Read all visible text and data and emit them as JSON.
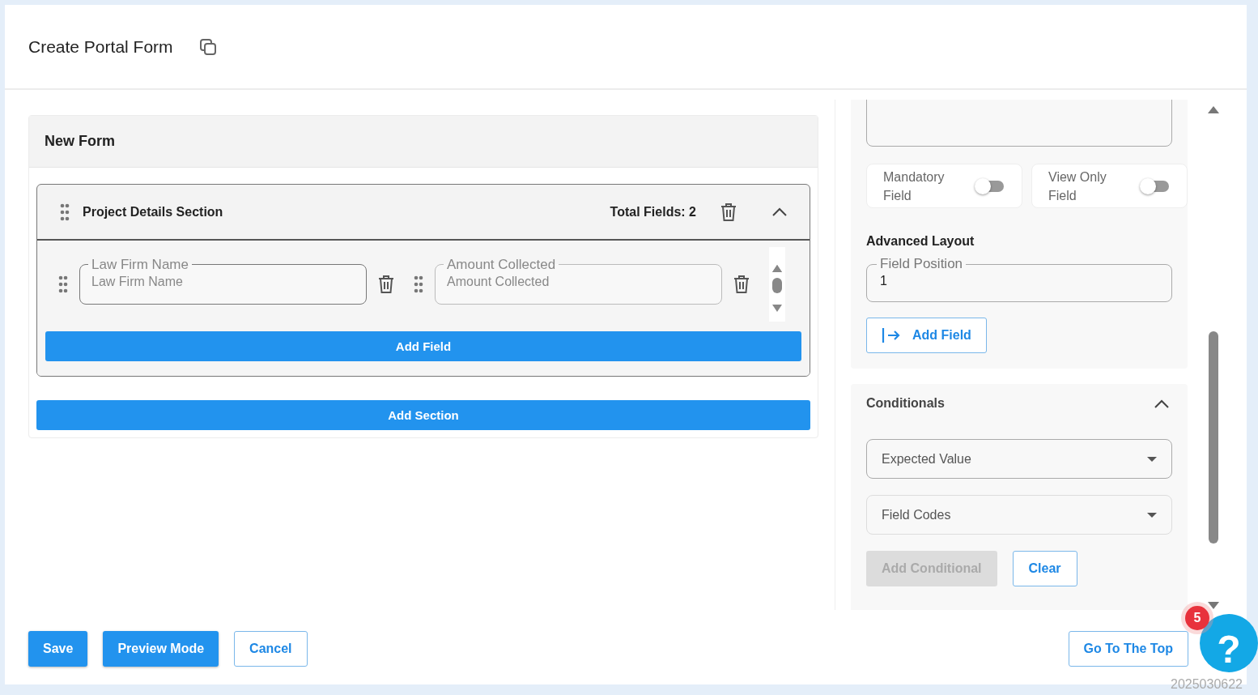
{
  "header": {
    "title": "Create Portal Form"
  },
  "form": {
    "title": "New Form",
    "sections": [
      {
        "title": "Project Details Section",
        "total": "Total Fields: 2",
        "expanded": true,
        "fields": [
          {
            "label": "Law Firm Name",
            "placeholder": "Law Firm Name"
          },
          {
            "label": "Amount Collected",
            "placeholder": "Amount Collected"
          }
        ],
        "add_field": "Add Field"
      }
    ],
    "add_section": "Add Section"
  },
  "properties": {
    "toggles": [
      {
        "label": "Mandatory Field",
        "on": false
      },
      {
        "label": "View Only Field",
        "on": false
      }
    ],
    "advanced_layout": {
      "title": "Advanced Layout",
      "field_position": {
        "label": "Field Position",
        "value": "1"
      },
      "add_field": "Add Field"
    },
    "conditionals": {
      "title": "Conditionals",
      "expanded": true,
      "selects": [
        {
          "placeholder": "Expected Value"
        },
        {
          "placeholder": "Field Codes"
        }
      ],
      "buttons": [
        {
          "label": "Add Conditional",
          "disabled": true
        },
        {
          "label": "Clear",
          "disabled": false
        }
      ]
    }
  },
  "footer": {
    "buttons": [
      {
        "label": "Save",
        "kind": "primary"
      },
      {
        "label": "Preview Mode",
        "kind": "primary"
      },
      {
        "label": "Cancel",
        "kind": "outline"
      }
    ],
    "top_button": "Go To The Top"
  },
  "help": {
    "icon": "?",
    "badge": "5"
  },
  "timestamp": "2025030622"
}
